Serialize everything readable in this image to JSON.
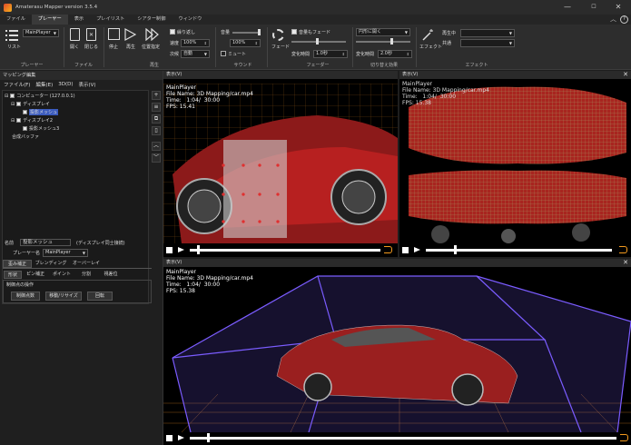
{
  "window": {
    "title": "Amaterasu Mapper version 3.5.4",
    "minimize": "—",
    "maximize": "☐",
    "close": "✕"
  },
  "menu": {
    "items": [
      "ファイル",
      "プレーヤー",
      "表示",
      "プレイリスト",
      "シアター制御",
      "ウィンドウ"
    ],
    "active_index": 1,
    "help": "?"
  },
  "ribbon": {
    "player": {
      "combo_value": "MainPlayer",
      "list_label": "リスト",
      "group_label": "プレーヤー"
    },
    "file": {
      "open": "開く",
      "close": "閉じる",
      "group_label": "ファイル"
    },
    "playback": {
      "stop": "停止",
      "play": "再生",
      "position": "位置指定",
      "loop": "繰り返し",
      "speed_label": "速度",
      "speed_value": "100%",
      "repeat_label": "次候",
      "repeat_value": "自動",
      "group_label": "再生"
    },
    "sound": {
      "volume_label": "音量",
      "volume_value": "100%",
      "mute": "ミュート",
      "group_label": "サウンド"
    },
    "fader": {
      "fade": "フェード",
      "volume_fade": "音量もフェード",
      "time_label": "変化時間",
      "time_value": "1.0秒",
      "group_label": "フェーダー"
    },
    "switch": {
      "combo_value": "円形に開く",
      "time_label": "変化時間",
      "time_value": "2.0秒",
      "group_label": "切り替え効果"
    },
    "effect": {
      "button": "エフェクト",
      "playing_label": "再生中",
      "common_label": "共通",
      "group_label": "エフェクト"
    }
  },
  "mapping_panel": {
    "title": "マッピング編集",
    "menu": [
      "ファイル(F)",
      "編集(E)",
      "3D(D)",
      "表示(V)"
    ],
    "tree": [
      {
        "label": "コンピューター (127.0.0.1)",
        "level": 0
      },
      {
        "label": "ディスプレイ",
        "level": 1
      },
      {
        "label": "投影メッシュ",
        "level": 2
      },
      {
        "label": "ディスプレイ2",
        "level": 1
      },
      {
        "label": "投影メッシュ3",
        "level": 2
      },
      {
        "label": "合成バッファ",
        "level": 0
      }
    ],
    "name_label": "名前",
    "name_value": "投影メッシュ",
    "name_note": "(ディスプレイ同士接続)",
    "player_label": "プレーヤー名",
    "player_value": "MainPlayer",
    "tabs": [
      "歪み補正",
      "ブレンディング",
      "オーバーレイ"
    ],
    "subtabs": [
      "形状",
      "ピン補正",
      "ポイント",
      "分割",
      "視差位"
    ],
    "section_label": "制御点の操作",
    "buttons": [
      "制御点数",
      "移動/リサイズ",
      "回転"
    ]
  },
  "views": [
    {
      "title": "表示(V)",
      "overlay": [
        "MainPlayer",
        "File Name: 3D Mapping/car.mp4",
        "Time:   1:04/  30:00",
        "FPS: 15.41"
      ],
      "progress": 0.04
    },
    {
      "title": "表示(V)",
      "overlay": [
        "MainPlayer",
        "File Name: 3D Mapping/car.mp4",
        "Time:   1:04/  30:00",
        "FPS: 15.38"
      ],
      "progress": 0.15
    },
    {
      "title": "表示(V)",
      "overlay": [
        "MainPlayer",
        "File Name: 3D Mapping/car.mp4",
        "Time:   1:04/  30:00",
        "FPS: 15.38"
      ],
      "progress": 0.04
    }
  ],
  "colors": {
    "accent": "#f39a1e",
    "wire_red": "#e03030",
    "wire_purple": "#7b5cff",
    "grid_orange": "#c87a1e"
  }
}
